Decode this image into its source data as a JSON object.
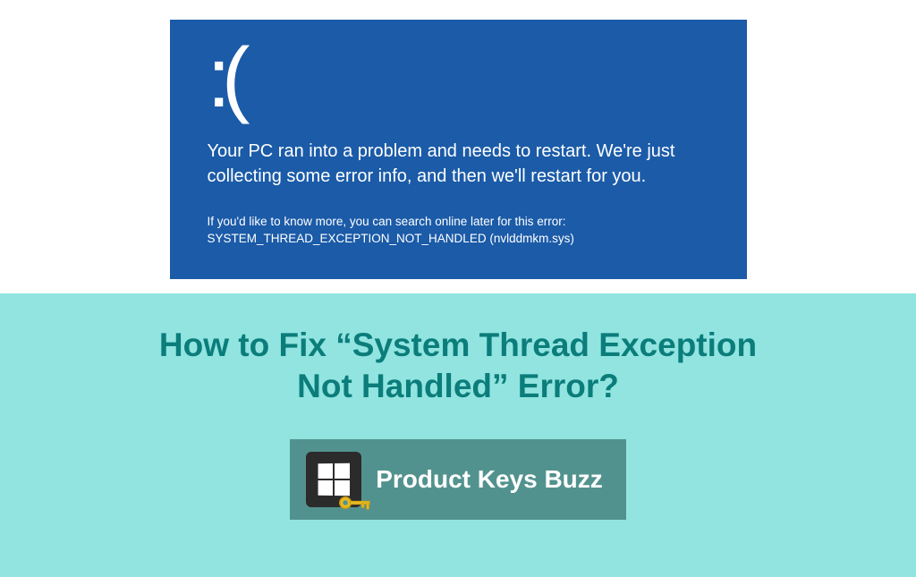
{
  "bsod": {
    "sad_face": ":(",
    "message": "Your PC ran into a problem and needs to restart. We're just collecting some error info, and then we'll restart for you.",
    "details_line1": "If you'd like to know more, you can search online later for this error:",
    "details_line2": "SYSTEM_THREAD_EXCEPTION_NOT_HANDLED (nvlddmkm.sys)"
  },
  "article": {
    "title": "How to Fix “System Thread Exception Not Handled” Error?"
  },
  "brand": {
    "name": "Product Keys Buzz"
  }
}
